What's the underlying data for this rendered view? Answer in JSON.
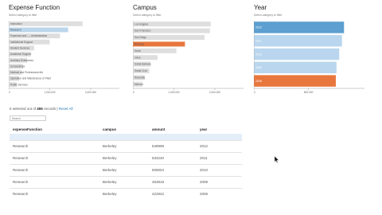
{
  "colors": {
    "bar_default": "#dedede",
    "bar_highlight": "#bcd6eb",
    "bar_selected": "#e8773d",
    "year_light": "#b9d6ee",
    "year_dark": "#5c9fd0",
    "link": "#2a7ab8"
  },
  "expense_panel": {
    "title": "Expense Function",
    "subtitle": "Select category to filter",
    "ticks": [
      "0",
      "1,000,000",
      "2,000,000"
    ],
    "chart_data": {
      "type": "bar",
      "orientation": "horizontal",
      "title": "Expense Function",
      "categories": [
        "Instruction",
        "Research",
        "Academic Support",
        "Student Services",
        "Institutional Support",
        "Operation and Maintenance of Plant",
        "Student Financial Aid",
        "Auxiliary Enterprises",
        "Hospitals",
        "Public Service",
        "Other"
      ],
      "category_labels": [
        "Instruction",
        "Research",
        "Expenses and ---- Administration",
        "Institutional Support",
        "Student Services",
        "Academic Support",
        "Auxiliary Enterprises",
        "Scholarships",
        "Medical and Professional Aid",
        "Operation and Maintenance of Plant",
        "Public Services"
      ],
      "values": [
        1800000,
        1450000,
        1250000,
        1000000,
        620000,
        540000,
        450000,
        350000,
        320000,
        250000,
        200000
      ],
      "states": [
        "default",
        "highlight",
        "default",
        "default",
        "default",
        "default",
        "default",
        "default",
        "default",
        "default",
        "default"
      ],
      "xlim": [
        0,
        2700000
      ]
    }
  },
  "campus_panel": {
    "title": "Campus",
    "subtitle": "Select category to filter",
    "ticks": [
      "0",
      "1,000,000",
      "2,000,000"
    ],
    "chart_data": {
      "type": "bar",
      "orientation": "horizontal",
      "title": "Campus",
      "categories": [
        "Los Angeles",
        "San Francisco",
        "San Diego",
        "Berkeley",
        "Davis",
        "Irvine",
        "Santa Barbara",
        "Santa Cruz",
        "Riverside",
        "Merced"
      ],
      "values": [
        1900000,
        1880000,
        1750000,
        1270000,
        1060000,
        600000,
        430000,
        400000,
        290000,
        230000
      ],
      "states": [
        "default",
        "default",
        "default",
        "selected",
        "default",
        "default",
        "default",
        "default",
        "default",
        "default"
      ],
      "xlim": [
        0,
        2700000
      ]
    }
  },
  "year_panel": {
    "title": "Year",
    "subtitle": "Select category to filter",
    "ticks": [
      "0",
      "800,000"
    ],
    "chart_data": {
      "type": "bar",
      "orientation": "horizontal",
      "title": "Year",
      "categories": [
        "2012",
        "2011",
        "2010",
        "2009",
        "2008"
      ],
      "values": [
        1320000,
        1290000,
        1250000,
        1210000,
        1200000
      ],
      "states": [
        "dark",
        "light",
        "light",
        "light",
        "selected"
      ],
      "xlim": [
        0,
        1620000
      ]
    }
  },
  "records": {
    "prefix": "5 selected out of",
    "count": "455",
    "suffix": "records |",
    "reset": "Reset All"
  },
  "search": {
    "placeholder": "Search"
  },
  "table": {
    "columns": [
      "expenseFunction",
      "campus",
      "amount",
      "year"
    ],
    "rows": [
      [
        "Research",
        "Berkeley",
        "549999",
        "2012"
      ],
      [
        "Research",
        "Berkeley",
        "633240",
        "2011"
      ],
      [
        "Research",
        "Berkeley",
        "508004",
        "2010"
      ],
      [
        "Research",
        "Berkeley",
        "463919",
        "2009"
      ],
      [
        "Research",
        "Berkeley",
        "422942",
        "2008"
      ]
    ]
  }
}
